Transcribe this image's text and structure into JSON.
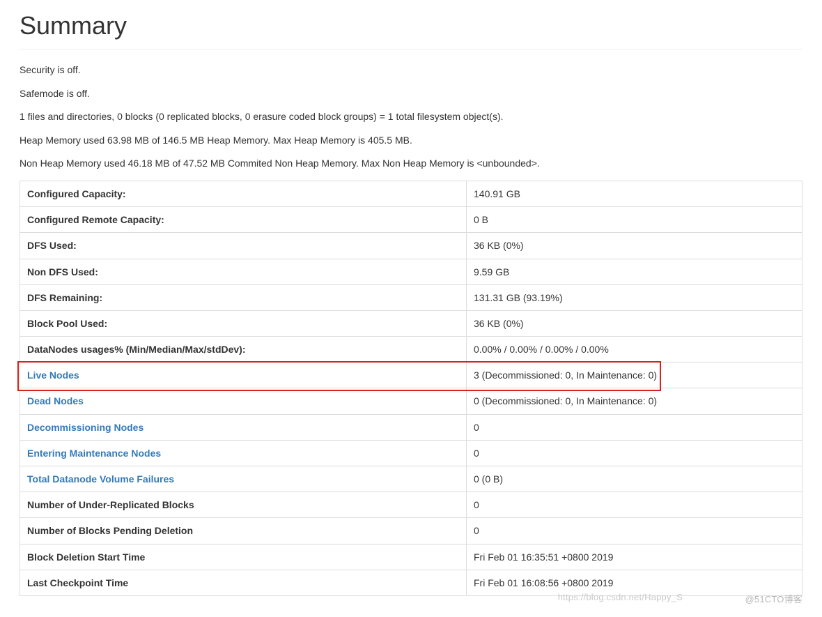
{
  "header": {
    "title": "Summary"
  },
  "status": {
    "security": "Security is off.",
    "safemode": "Safemode is off.",
    "filesystem": "1 files and directories, 0 blocks (0 replicated blocks, 0 erasure coded block groups) = 1 total filesystem object(s).",
    "heap": "Heap Memory used 63.98 MB of 146.5 MB Heap Memory. Max Heap Memory is 405.5 MB.",
    "nonheap": "Non Heap Memory used 46.18 MB of 47.52 MB Commited Non Heap Memory. Max Non Heap Memory is <unbounded>."
  },
  "rows": {
    "configured_capacity": {
      "label": "Configured Capacity:",
      "value": "140.91 GB"
    },
    "configured_remote_capacity": {
      "label": "Configured Remote Capacity:",
      "value": "0 B"
    },
    "dfs_used": {
      "label": "DFS Used:",
      "value": "36 KB (0%)"
    },
    "non_dfs_used": {
      "label": "Non DFS Used:",
      "value": "9.59 GB"
    },
    "dfs_remaining": {
      "label": "DFS Remaining:",
      "value": "131.31 GB (93.19%)"
    },
    "block_pool_used": {
      "label": "Block Pool Used:",
      "value": "36 KB (0%)"
    },
    "datanodes_usages": {
      "label": "DataNodes usages% (Min/Median/Max/stdDev):",
      "value": "0.00% / 0.00% / 0.00% / 0.00%"
    },
    "live_nodes": {
      "label": "Live Nodes",
      "value": "3 (Decommissioned: 0, In Maintenance: 0)"
    },
    "dead_nodes": {
      "label": "Dead Nodes",
      "value": "0 (Decommissioned: 0, In Maintenance: 0)"
    },
    "decommissioning_nodes": {
      "label": "Decommissioning Nodes",
      "value": "0"
    },
    "entering_maintenance_nodes": {
      "label": "Entering Maintenance Nodes",
      "value": "0"
    },
    "total_datanode_volume_failures": {
      "label": "Total Datanode Volume Failures",
      "value": "0 (0 B)"
    },
    "under_replicated_blocks": {
      "label": "Number of Under-Replicated Blocks",
      "value": "0"
    },
    "blocks_pending_deletion": {
      "label": "Number of Blocks Pending Deletion",
      "value": "0"
    },
    "block_deletion_start_time": {
      "label": "Block Deletion Start Time",
      "value": "Fri Feb 01 16:35:51 +0800 2019"
    },
    "last_checkpoint_time": {
      "label": "Last Checkpoint Time",
      "value": "Fri Feb 01 16:08:56 +0800 2019"
    }
  },
  "watermark": {
    "left": "https://blog.csdn.net/Happy_S",
    "right": "@51CTO博客"
  }
}
